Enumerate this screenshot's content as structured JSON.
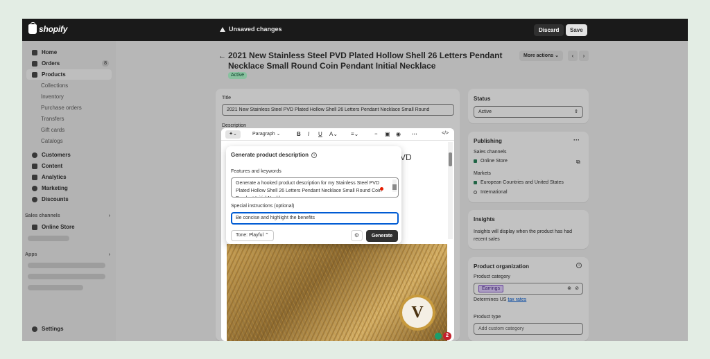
{
  "topbar": {
    "logo": "shopify",
    "unsaved": "Unsaved changes",
    "discard": "Discard",
    "save": "Save"
  },
  "sidebar": {
    "items": [
      {
        "label": "Home"
      },
      {
        "label": "Orders",
        "count": "8"
      },
      {
        "label": "Products"
      },
      {
        "label": "Collections"
      },
      {
        "label": "Inventory"
      },
      {
        "label": "Purchase orders"
      },
      {
        "label": "Transfers"
      },
      {
        "label": "Gift cards"
      },
      {
        "label": "Catalogs"
      },
      {
        "label": "Customers"
      },
      {
        "label": "Content"
      },
      {
        "label": "Analytics"
      },
      {
        "label": "Marketing"
      },
      {
        "label": "Discounts"
      }
    ],
    "sales_channels": "Sales channels",
    "online_store": "Online Store",
    "apps": "Apps",
    "settings": "Settings",
    "chevron": "›"
  },
  "product": {
    "title": "2021 New Stainless Steel PVD Plated Hollow Shell 26 Letters Pendant Necklace Small Round Coin Pendant Initial Necklace",
    "status_badge": "Active",
    "more_actions": "More actions ⌄",
    "prev": "‹",
    "next": "›",
    "back": "←"
  },
  "title_card": {
    "title_label": "Title",
    "title_value": "2021 New Stainless Steel PVD Plated Hollow Shell 26 Letters Pendant Necklace Small Round",
    "description_label": "Description",
    "desc_peek": "VD"
  },
  "toolbar": {
    "paragraph": "Paragraph ⌄",
    "bold": "B",
    "italic": "I",
    "underline": "U",
    "color": "A⌄",
    "align": "≡⌄",
    "more": "···",
    "code": "</>"
  },
  "generate_popup": {
    "title": "Generate product description",
    "features_label": "Features and keywords",
    "features_value": "Generate a hooked product description  for my Stainless Steel PVD Plated Hollow Shell 26 Letters Pendant Necklace Small Round Coin Pendant Initial Necklace",
    "special_label": "Special instructions (optional)",
    "special_value": "Be concise and highlight the benefits",
    "tone": "Tone: Playful ⌃",
    "generate": "Generate"
  },
  "image_letter": "V",
  "image_badge": "2",
  "status_card": {
    "heading": "Status",
    "value": "Active"
  },
  "publishing": {
    "heading": "Publishing",
    "more": "···",
    "sales_channels": "Sales channels",
    "online_store": "Online Store",
    "markets": "Markets",
    "market_1": "European Countries and United States",
    "market_2": "International"
  },
  "insights": {
    "heading": "Insights",
    "text": "Insights will display when the product has had recent sales"
  },
  "organization": {
    "heading": "Product organization",
    "category_label": "Product category",
    "category_value": "Earrings",
    "determines": "Determines US",
    "tax_rates": "tax rates",
    "type_label": "Product type",
    "type_placeholder": "Add custom category"
  },
  "colors": {
    "topbar": "#1a1a1a",
    "accent_focus": "#005bd3",
    "active_badge": "#b4fed2",
    "online_dot": "#29845a"
  }
}
